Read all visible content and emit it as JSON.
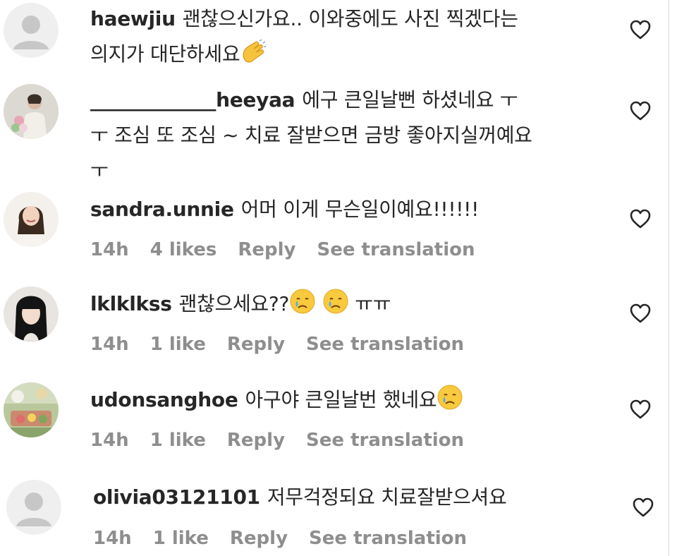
{
  "comments": [
    {
      "username": "haewjiu",
      "lines": [
        "괜찮으신가요.. 이와중에도 사진 찍겠다는",
        "의지가 대단하세요"
      ],
      "emoji": [
        "clapping-hands"
      ],
      "meta": null,
      "avatar": "default"
    },
    {
      "username": "_____________heeyaa",
      "lines": [
        "에구 큰일날뻔 하셨네요 ㅜ",
        "ㅜ 조심 또 조심 ~ 치료 잘받으면 금방 좋아지실꺼예요",
        "ㅜ"
      ],
      "meta": null,
      "avatar": "photo-girl-flowers"
    },
    {
      "username": "sandra.unnie",
      "lines": [
        "어머 이게 무슨일이예요!!!!!!"
      ],
      "meta": {
        "time": "14h",
        "likes": "4 likes",
        "reply": "Reply",
        "translate": "See translation"
      },
      "avatar": "photo-woman-smiling"
    },
    {
      "username": "lklklkss",
      "lines": [
        "괜찮으세요??",
        "ㅠㅠ"
      ],
      "emoji": [
        "crying-face",
        "crying-face"
      ],
      "meta": {
        "time": "14h",
        "likes": "1 like",
        "reply": "Reply",
        "translate": "See translation"
      },
      "avatar": "photo-girl-dark-hair"
    },
    {
      "username": "udonsanghoe",
      "lines": [
        "아구야 큰일날번 했네요"
      ],
      "emoji": [
        "crying-face"
      ],
      "meta": {
        "time": "14h",
        "likes": "1 like",
        "reply": "Reply",
        "translate": "See translation"
      },
      "avatar": "photo-garden-party"
    },
    {
      "username": "olivia03121101",
      "lines": [
        "저무걱정되요 치료잘받으셔요"
      ],
      "meta": {
        "time": "14h",
        "likes": "1 like",
        "reply": "Reply",
        "translate": "See translation"
      },
      "avatar": "default"
    }
  ],
  "icons": {
    "like": "heart-outline-icon",
    "default_avatar": "default-avatar-icon"
  },
  "colors": {
    "text": "#262626",
    "meta": "#8e8e8e",
    "default_avatar_bg": "#efefef",
    "default_avatar_fg": "#c7c7c7"
  }
}
